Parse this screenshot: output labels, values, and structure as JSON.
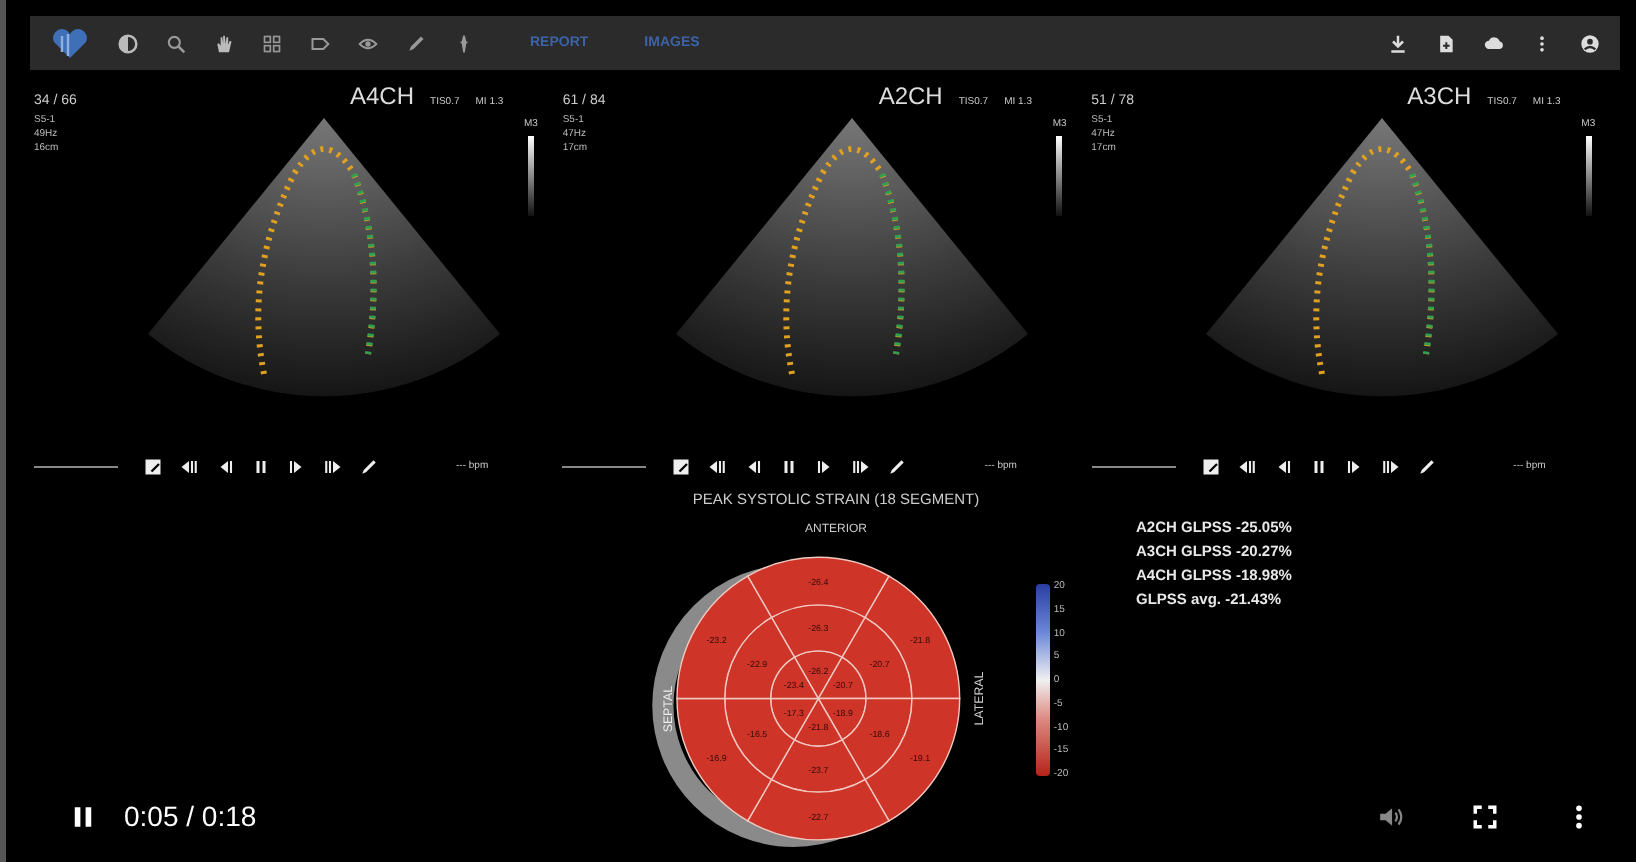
{
  "toolbar": {
    "links": [
      {
        "label": "REPORT"
      },
      {
        "label": "IMAGES"
      }
    ]
  },
  "panels": [
    {
      "counter": "34 / 66",
      "view": "A4CH",
      "tis": "TIS0.7",
      "mi": "MI 1.3",
      "map": "M3",
      "info": [
        "S5-1",
        "49Hz",
        "16cm"
      ],
      "bpm": "--- bpm"
    },
    {
      "counter": "61 / 84",
      "view": "A2CH",
      "tis": "TIS0.7",
      "mi": "MI 1.3",
      "map": "M3",
      "info": [
        "S5-1",
        "47Hz",
        "17cm"
      ],
      "bpm": "--- bpm"
    },
    {
      "counter": "51 / 78",
      "view": "A3CH",
      "tis": "TIS0.7",
      "mi": "MI 1.3",
      "map": "M3",
      "info": [
        "S5-1",
        "47Hz",
        "17cm"
      ],
      "bpm": "--- bpm"
    }
  ],
  "bullseye": {
    "title": "PEAK SYSTOLIC STRAIN (18 SEGMENT)",
    "anterior": "ANTERIOR",
    "septal": "SEPTAL",
    "lateral": "LATERAL",
    "outer": [
      "-26.4",
      "-21.8",
      "-19.1",
      "-22.7",
      "-16.9",
      "-23.2"
    ],
    "middle": [
      "-26.3",
      "-20.7",
      "-18.6",
      "-23.7",
      "-16.5",
      "-22.9"
    ],
    "inner": [
      "-26.2",
      "-20.7",
      "-18.9",
      "-21.8",
      "-17.3",
      "-23.4"
    ],
    "scale_ticks": [
      "20",
      "15",
      "10",
      "5",
      "0",
      "-5",
      "-10",
      "-15",
      "-20"
    ]
  },
  "results": [
    "A2CH GLPSS -25.05%",
    "A3CH GLPSS -20.27%",
    "A4CH GLPSS -18.98%",
    "GLPSS avg. -21.43%"
  ],
  "player": {
    "playing": true,
    "time": "0:05 / 0:18"
  }
}
